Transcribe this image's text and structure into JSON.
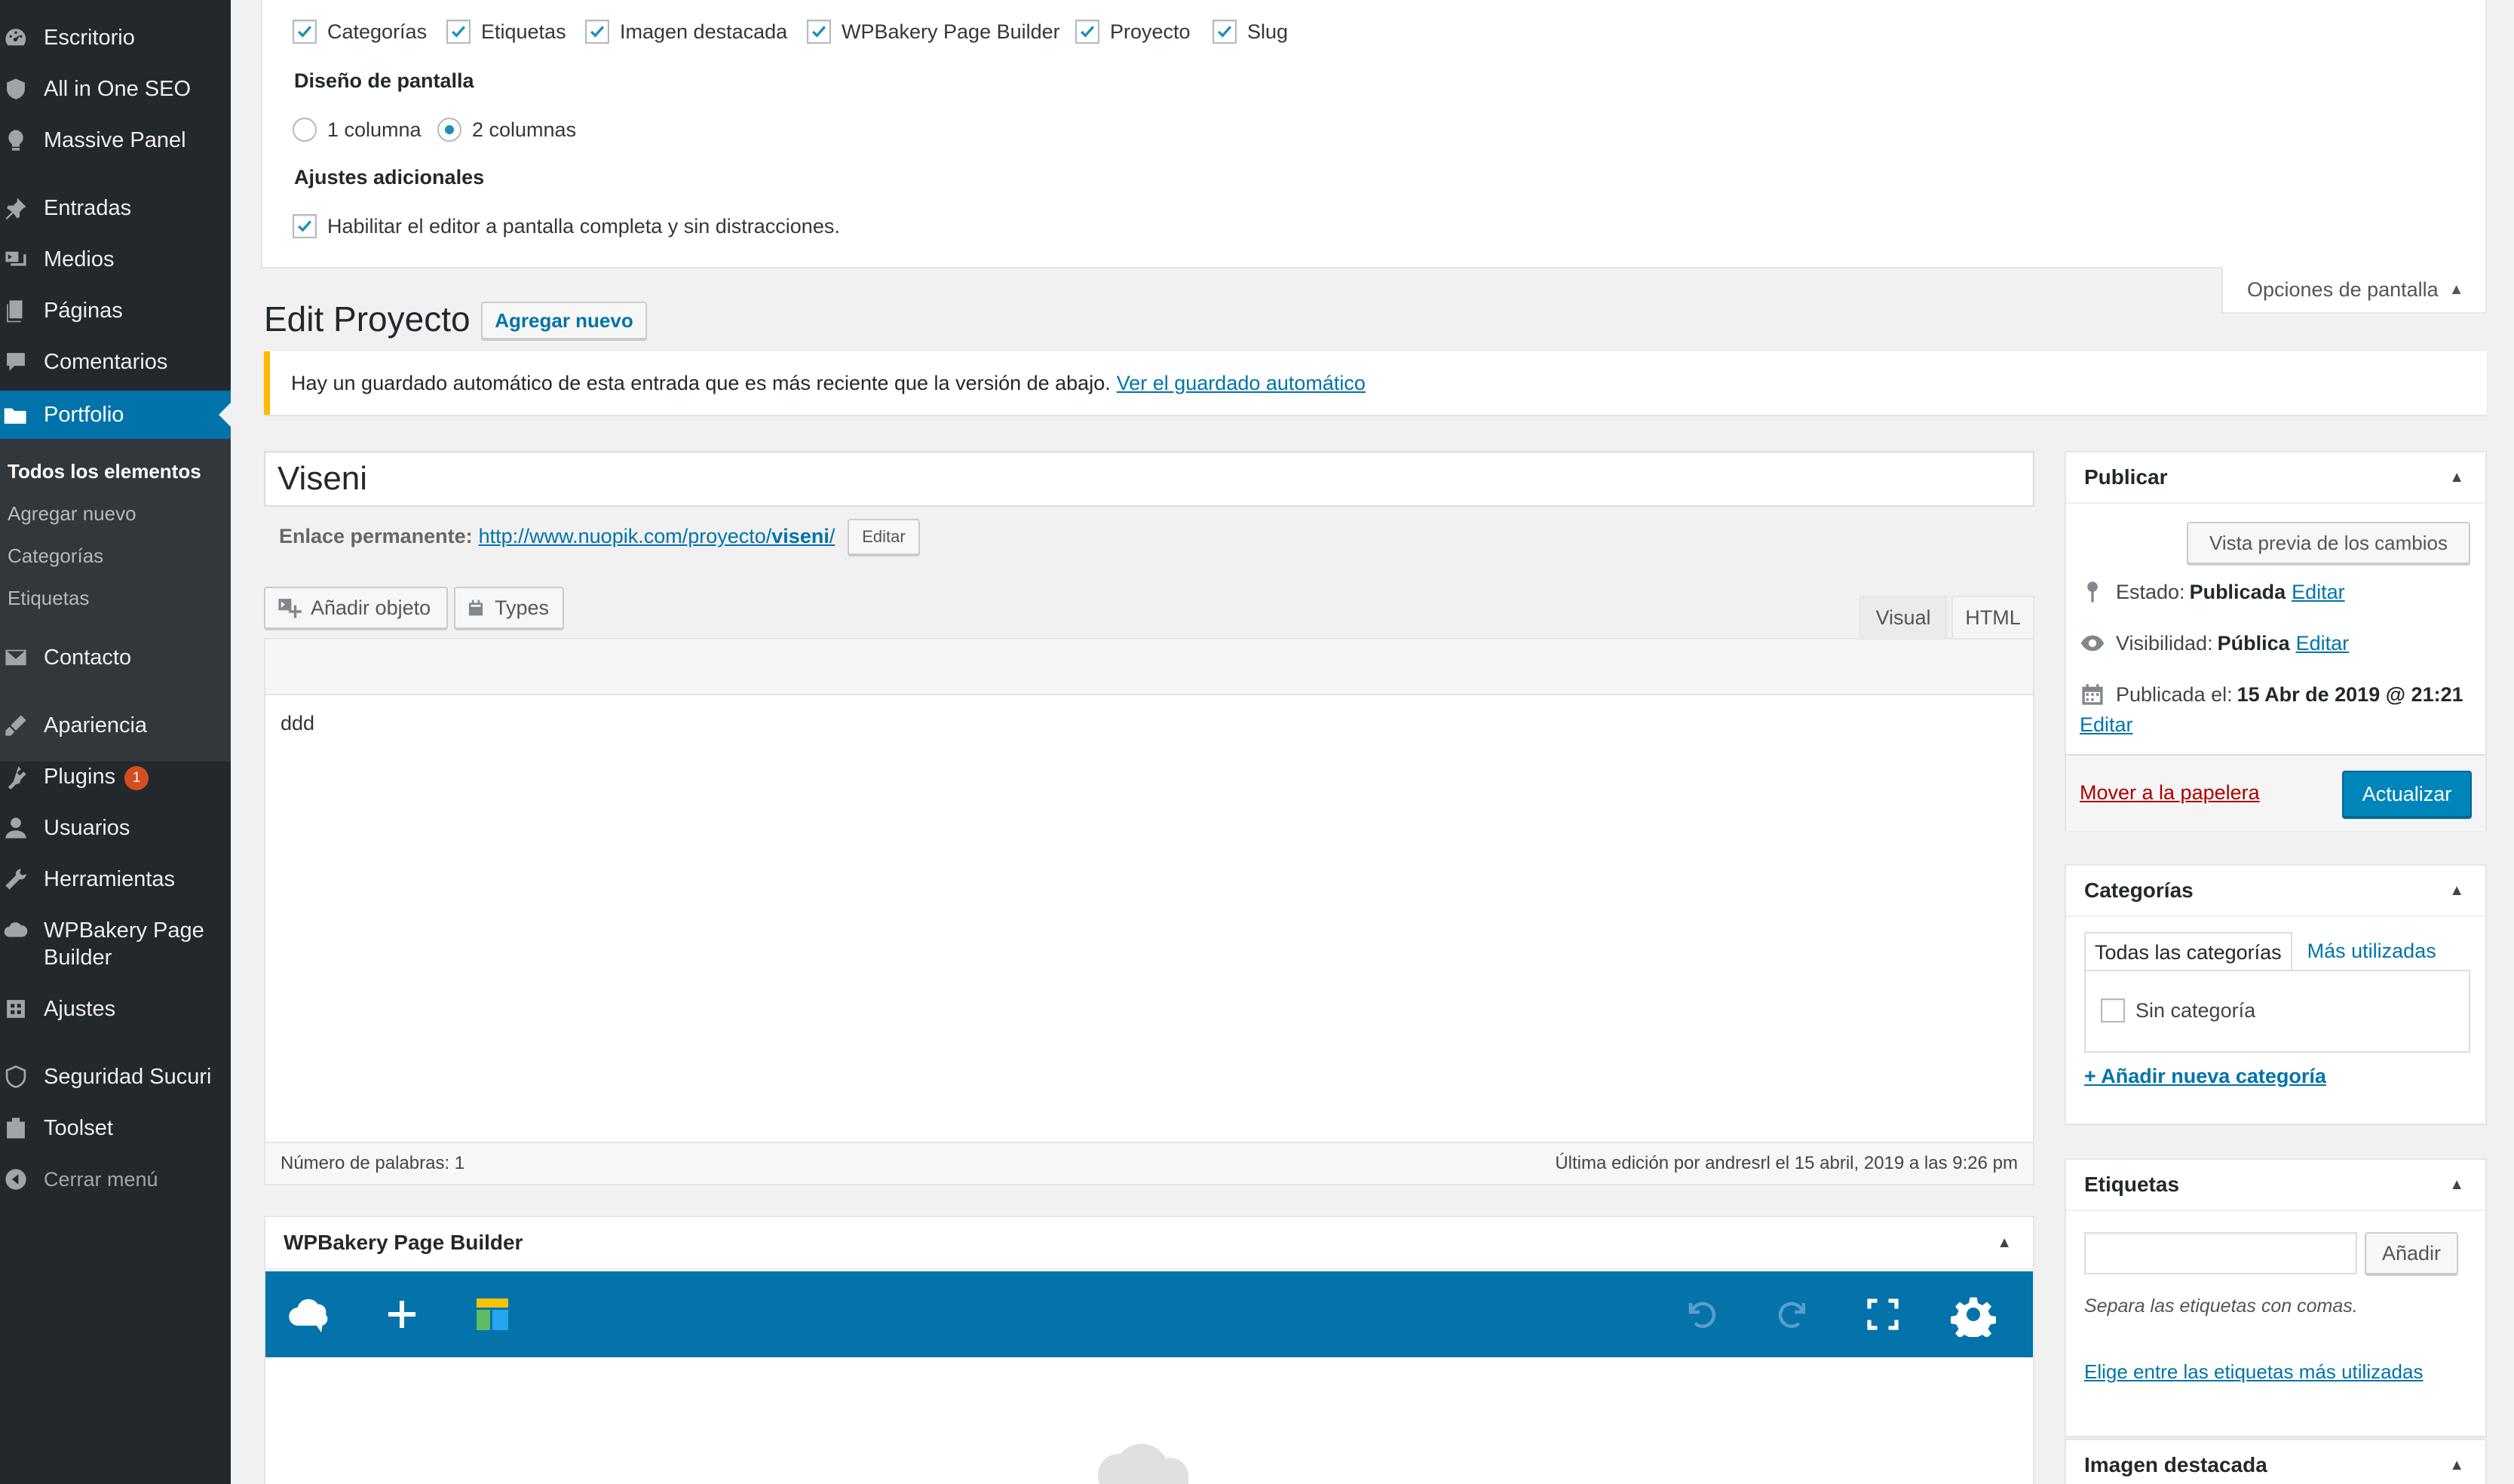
{
  "sidebar": {
    "items": [
      {
        "label": "Escritorio",
        "icon": "dashboard-icon"
      },
      {
        "label": "All in One SEO",
        "icon": "shield-icon"
      },
      {
        "label": "Massive Panel",
        "icon": "lightbulb-icon"
      },
      {
        "label": "Entradas",
        "icon": "pin-icon"
      },
      {
        "label": "Medios",
        "icon": "media-icon"
      },
      {
        "label": "Páginas",
        "icon": "pages-icon"
      },
      {
        "label": "Comentarios",
        "icon": "comment-icon"
      },
      {
        "label": "Portfolio",
        "icon": "folder-icon"
      },
      {
        "label": "Contacto",
        "icon": "mail-icon"
      },
      {
        "label": "Apariencia",
        "icon": "brush-icon"
      },
      {
        "label": "Plugins",
        "icon": "plugin-icon",
        "badge": "1"
      },
      {
        "label": "Usuarios",
        "icon": "user-icon"
      },
      {
        "label": "Herramientas",
        "icon": "wrench-icon"
      },
      {
        "label": "WPBakery Page Builder",
        "icon": "cloud-icon"
      },
      {
        "label": "Ajustes",
        "icon": "settings-icon"
      },
      {
        "label": "Seguridad Sucuri",
        "icon": "sucuri-icon"
      },
      {
        "label": "Toolset",
        "icon": "toolset-icon"
      },
      {
        "label": "Cerrar menú",
        "icon": "collapse-icon"
      }
    ],
    "submenu": [
      "Todos los elementos",
      "Agregar nuevo",
      "Categorías",
      "Etiquetas"
    ]
  },
  "screen_options": {
    "checkboxes": [
      "Categorías",
      "Etiquetas",
      "Imagen destacada",
      "WPBakery Page Builder",
      "Proyecto",
      "Slug"
    ],
    "layout_heading": "Diseño de pantalla",
    "layout_options": [
      "1 columna",
      "2 columnas"
    ],
    "layout_selected": "2 columnas",
    "extra_heading": "Ajustes adicionales",
    "extra_checkbox": "Habilitar el editor a pantalla completa y sin distracciones.",
    "tab_label": "Opciones de pantalla"
  },
  "page": {
    "title": "Edit Proyecto",
    "add_new": "Agregar nuevo"
  },
  "notice": {
    "text": "Hay un guardado automático de esta entrada que es más reciente que la versión de abajo.",
    "link": "Ver el guardado automático"
  },
  "post": {
    "title": "Viseni",
    "permalink_label": "Enlace permanente:",
    "permalink_base": "http://www.nuopik.com/proyecto/",
    "permalink_slug": "viseni",
    "permalink_end": "/",
    "permalink_edit": "Editar"
  },
  "editor": {
    "add_media": "Añadir objeto",
    "types": "Types",
    "tab_visual": "Visual",
    "tab_html": "HTML",
    "content": "ddd",
    "word_count": "Número de palabras: 1",
    "last_edit": "Última edición por andresrl el 15 abril, 2019 a las 9:26 pm"
  },
  "vc": {
    "title": "WPBakery Page Builder",
    "tools": [
      "cloud-logo-icon",
      "plus-icon",
      "template-icon",
      "undo-icon",
      "redo-icon",
      "fullscreen-icon",
      "gear-icon"
    ]
  },
  "publish": {
    "title": "Publicar",
    "preview": "Vista previa de los cambios",
    "status_label": "Estado:",
    "status_value": "Publicada",
    "visibility_label": "Visibilidad:",
    "visibility_value": "Pública",
    "date_label": "Publicada el:",
    "date_value": "15 Abr de 2019 @ 21:21",
    "edit": "Editar",
    "trash": "Mover a la papelera",
    "update": "Actualizar"
  },
  "categories": {
    "title": "Categorías",
    "tab_all": "Todas las categorías",
    "tab_popular": "Más utilizadas",
    "item": "Sin categoría",
    "add_new": "+ Añadir nueva categoría"
  },
  "tags": {
    "title": "Etiquetas",
    "add": "Añadir",
    "hint": "Separa las etiquetas con comas.",
    "choose": "Elige entre las etiquetas más utilizadas"
  },
  "featured": {
    "title": "Imagen destacada"
  },
  "colors": {
    "sidebar_bg": "#23282d",
    "accent": "#0073aa",
    "notice_border": "#ffb900",
    "vc_toolbar": "#0473aa",
    "trash": "#a00"
  }
}
